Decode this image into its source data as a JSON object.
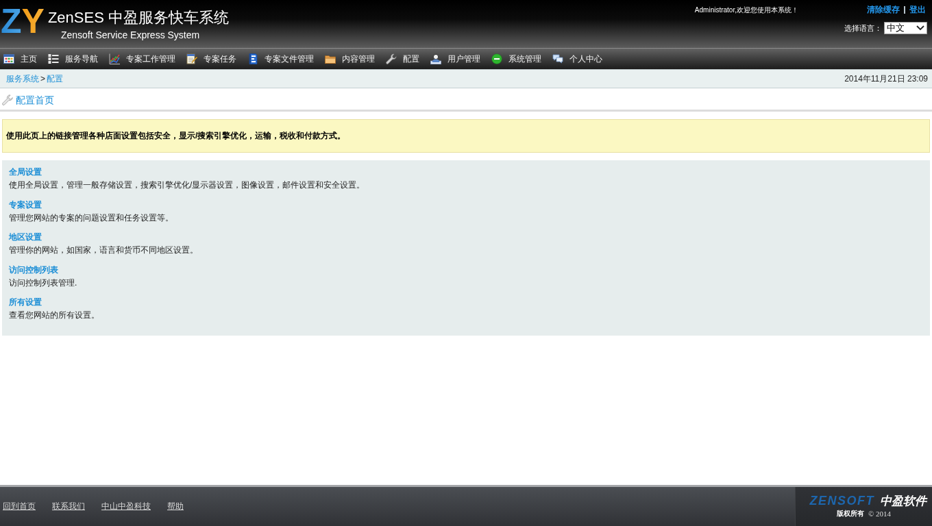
{
  "header": {
    "logo_mark": "ZY",
    "title": "ZenSES 中盈服务快车系统",
    "subtitle": "Zensoft Service Express System",
    "welcome": "Administrator,欢迎您使用本系统！",
    "links": [
      "清除缓存",
      "登出"
    ],
    "language": {
      "label": "选择语言：",
      "value": "中文"
    }
  },
  "nav": {
    "items": [
      "主页",
      "服务导航",
      "专案工作管理",
      "专案任务",
      "专案文件管理",
      "内容管理",
      "配置",
      "用户管理",
      "系统管理",
      "个人中心"
    ]
  },
  "breadcrumb": {
    "items": [
      "服务系统",
      "配置"
    ],
    "separator": ">",
    "datetime": "2014年11月21日 23:09"
  },
  "page_title": "配置首页",
  "notice": "使用此页上的链接管理各种店面设置包括安全，显示/搜索引擎优化，运输，税收和付款方式。",
  "sections": [
    {
      "title": "全局设置",
      "description": "使用全局设置，管理一般存储设置，搜索引擎优化/显示器设置，图像设置，邮件设置和安全设置。"
    },
    {
      "title": "专案设置",
      "description": "管理您网站的专案的问题设置和任务设置等。"
    },
    {
      "title": "地区设置",
      "description": "管理你的网站，如国家，语言和货币不同地区设置。"
    },
    {
      "title": "访问控制列表",
      "description": "访问控制列表管理."
    },
    {
      "title": "所有设置",
      "description": "查看您网站的所有设置。"
    }
  ],
  "footer": {
    "links": [
      "回到首页",
      "联系我们",
      "中山中盈科技",
      "帮助"
    ],
    "brand": "ZENSOFT",
    "brand_cn": "中盈软件",
    "copyright_holder": "版权所有",
    "copyright_year": "© 2014"
  }
}
